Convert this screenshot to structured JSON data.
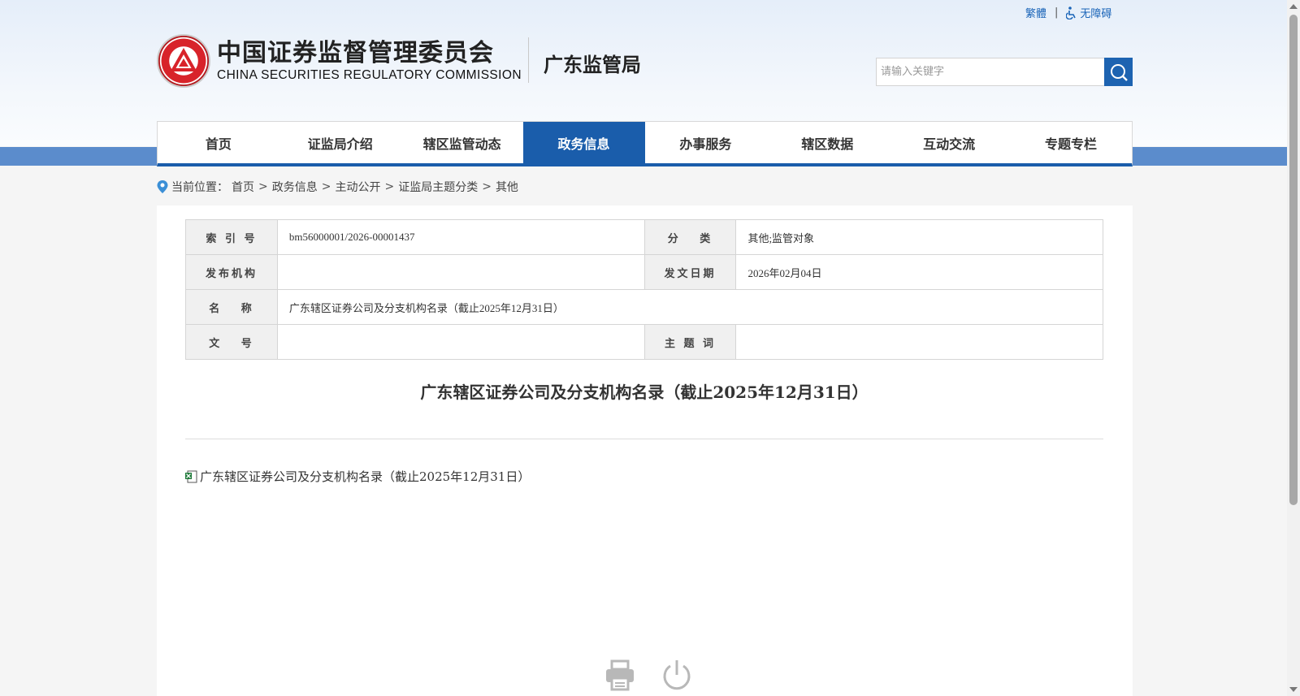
{
  "header": {
    "traditional_link": "繁體",
    "separator": "|",
    "accessibility_link": "无障碍",
    "logo_cn": "中国证券监督管理委员会",
    "logo_en": "CHINA SECURITIES REGULATORY COMMISSION",
    "bureau_name": "广东监管局",
    "search_placeholder": "请输入关键字"
  },
  "nav": {
    "items": [
      {
        "label": "首页"
      },
      {
        "label": "证监局介绍"
      },
      {
        "label": "辖区监管动态"
      },
      {
        "label": "政务信息",
        "active": true
      },
      {
        "label": "办事服务"
      },
      {
        "label": "辖区数据"
      },
      {
        "label": "互动交流"
      },
      {
        "label": "专题专栏"
      }
    ]
  },
  "breadcrumb": {
    "prefix": "当前位置：",
    "items": [
      "首页",
      "政务信息",
      "主动公开",
      "证监局主题分类",
      "其他"
    ],
    "separator": ">"
  },
  "meta": {
    "index_label": "索 引 号",
    "index_value": "bm56000001/2026-00001437",
    "category_label": "分　 类",
    "category_value": "其他;监管对象",
    "publisher_label": "发布机构",
    "publisher_value": "",
    "date_label": "发文日期",
    "date_value": "2026年02月04日",
    "name_label": "名　 称",
    "name_value": "广东辖区证券公司及分支机构名录（截止2025年12月31日）",
    "docno_label": "文　 号",
    "docno_value": "",
    "keywords_label": "主 题 词",
    "keywords_value": ""
  },
  "document": {
    "title": "广东辖区证券公司及分支机构名录（截止2025年12月31日）",
    "attachment_name": "广东辖区证券公司及分支机构名录（截止2025年12月31日）"
  },
  "colors": {
    "primary_blue": "#1a5dab",
    "band_blue": "#5b8ccc",
    "link_blue": "#1a64b8"
  }
}
